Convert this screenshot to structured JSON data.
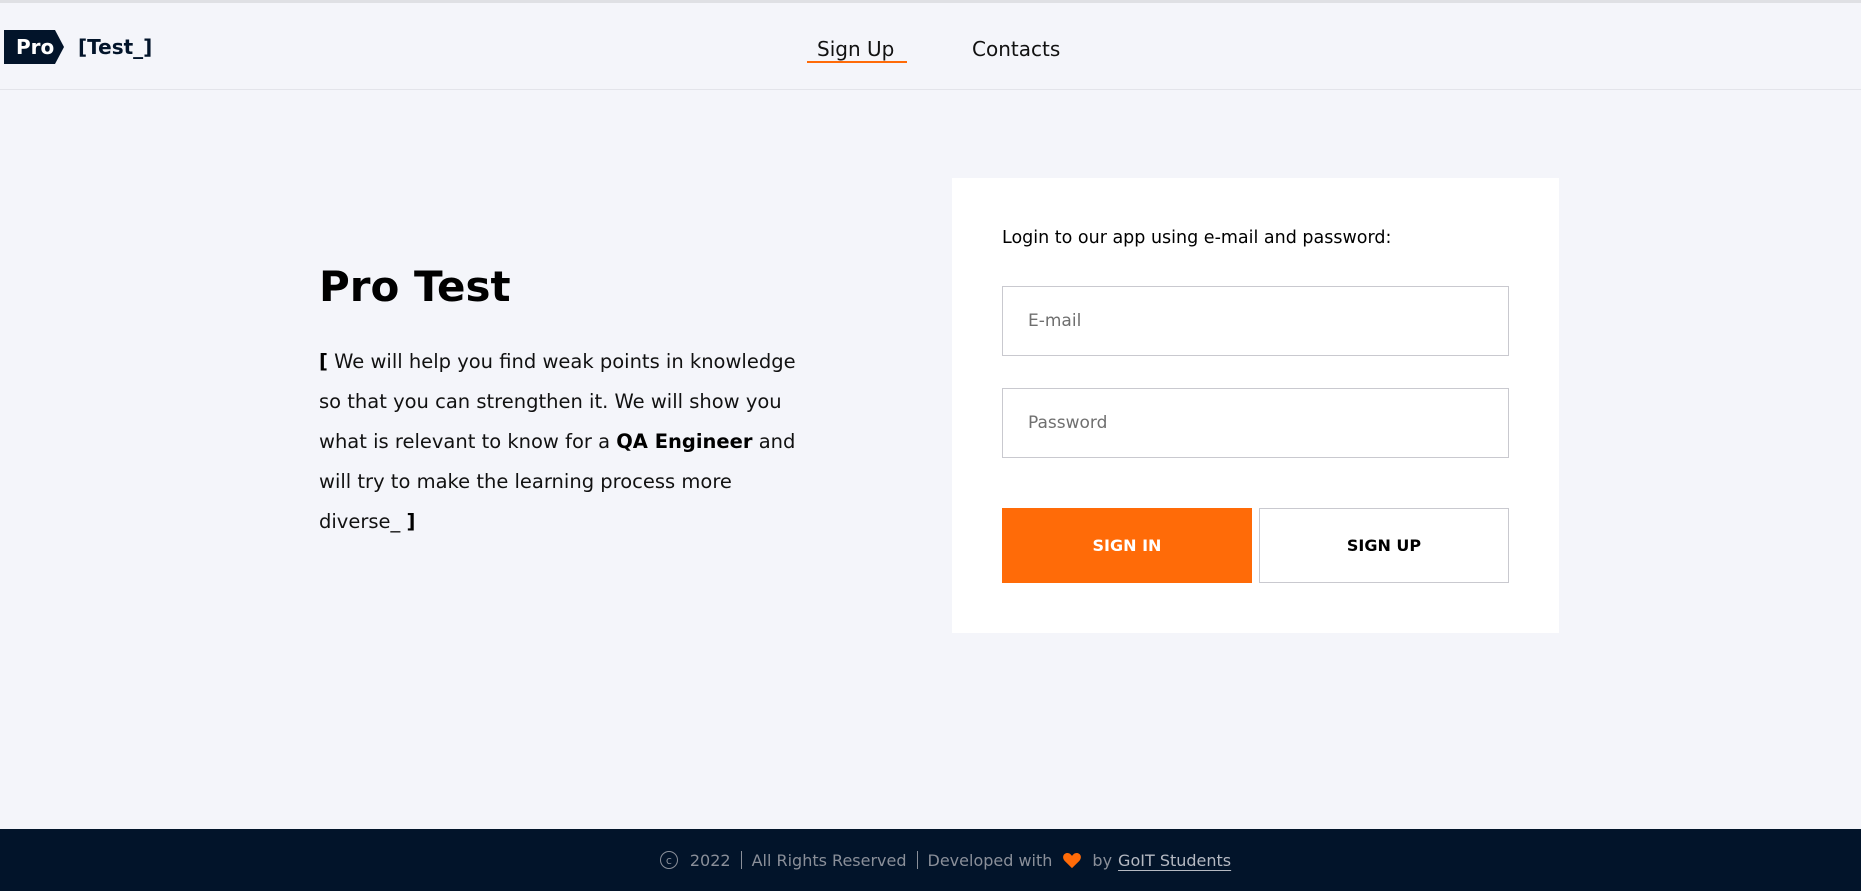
{
  "header": {
    "logo": {
      "pro": "Pro",
      "test": "[Test_]"
    },
    "nav": [
      {
        "label": "Sign Up",
        "active": true
      },
      {
        "label": "Contacts",
        "active": false
      }
    ]
  },
  "hero": {
    "title": "Pro Test",
    "bracket_open": "[",
    "text_1": " We will help you find weak points in knowledge so that you can strengthen it. We will show you what is relevant to know for a ",
    "text_bold": "QA Engineer",
    "text_2": " and will try to make the learning process more diverse_ ",
    "bracket_close": "]"
  },
  "login": {
    "heading": "Login to our app using e-mail and password:",
    "email_placeholder": "E-mail",
    "email_value": "",
    "password_placeholder": "Password",
    "password_value": "",
    "signin_label": "SIGN IN",
    "signup_label": "SIGN UP"
  },
  "footer": {
    "copyright_symbol": "c",
    "year": "2022",
    "rights": "All Rights Reserved",
    "developed": "Developed with",
    "by": "by",
    "link": "GoIT Students"
  },
  "colors": {
    "accent": "#ff6b08",
    "dark": "#02142a",
    "background": "#f4f5fa"
  },
  "icons": {
    "heart": "heart-icon",
    "copyright": "copyright-icon"
  }
}
